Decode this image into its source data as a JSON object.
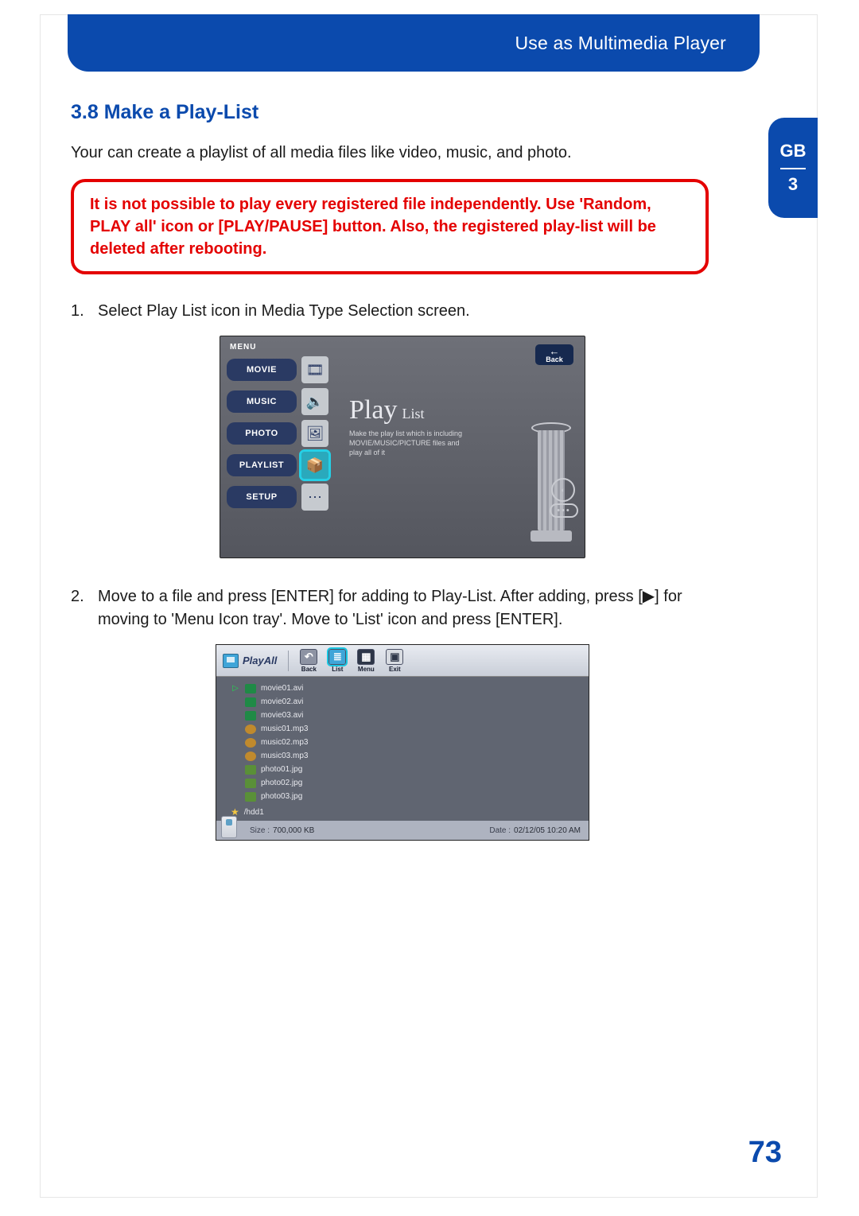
{
  "header": {
    "title": "Use as Multimedia Player"
  },
  "side_tab": {
    "lang": "GB",
    "chapter": "3"
  },
  "section": {
    "heading": "3.8 Make a Play-List"
  },
  "intro": "Your can create a playlist of all media files like video, music, and photo.",
  "warning": "It is not possible to play every registered file independently. Use 'Random, PLAY all' icon or [PLAY/PAUSE] button. Also, the registered play-list will be deleted after rebooting.",
  "steps": {
    "s1_num": "1.",
    "s1_text": "Select Play List icon in Media Type Selection screen.",
    "s2_num": "2.",
    "s2_text": "Move to a file and press [ENTER] for adding to Play-List. After adding, press [▶] for moving to 'Menu Icon tray'. Move to 'List' icon and press [ENTER]."
  },
  "fig1": {
    "menu_header": "MENU",
    "items": {
      "movie": "MOVIE",
      "music": "MUSIC",
      "photo": "PHOTO",
      "playlist": "PLAYLIST",
      "setup": "SETUP"
    },
    "back_label": "Back",
    "title_main": "Play",
    "title_sub": "List",
    "desc": "Make the play list which is including MOVIE/MUSIC/PICTURE files and play all of it"
  },
  "fig2": {
    "play_all": "PlayAll",
    "toolbar": {
      "back": "Back",
      "list": "List",
      "menu": "Menu",
      "exit": "Exit"
    },
    "files": [
      {
        "type": "movie",
        "name": "movie01.avi",
        "playing": true
      },
      {
        "type": "movie",
        "name": "movie02.avi",
        "playing": false
      },
      {
        "type": "movie",
        "name": "movie03.avi",
        "playing": false
      },
      {
        "type": "music",
        "name": "music01.mp3",
        "playing": false
      },
      {
        "type": "music",
        "name": "music02.mp3",
        "playing": false
      },
      {
        "type": "music",
        "name": "music03.mp3",
        "playing": false
      },
      {
        "type": "photo",
        "name": "photo01.jpg",
        "playing": false
      },
      {
        "type": "photo",
        "name": "photo02.jpg",
        "playing": false
      },
      {
        "type": "photo",
        "name": "photo03.jpg",
        "playing": false
      }
    ],
    "folder": "/hdd1",
    "status": {
      "size_label": "Size :",
      "size_value": "700,000 KB",
      "date_label": "Date :",
      "date_value": "02/12/05  10:20  AM"
    }
  },
  "page_number": "73"
}
